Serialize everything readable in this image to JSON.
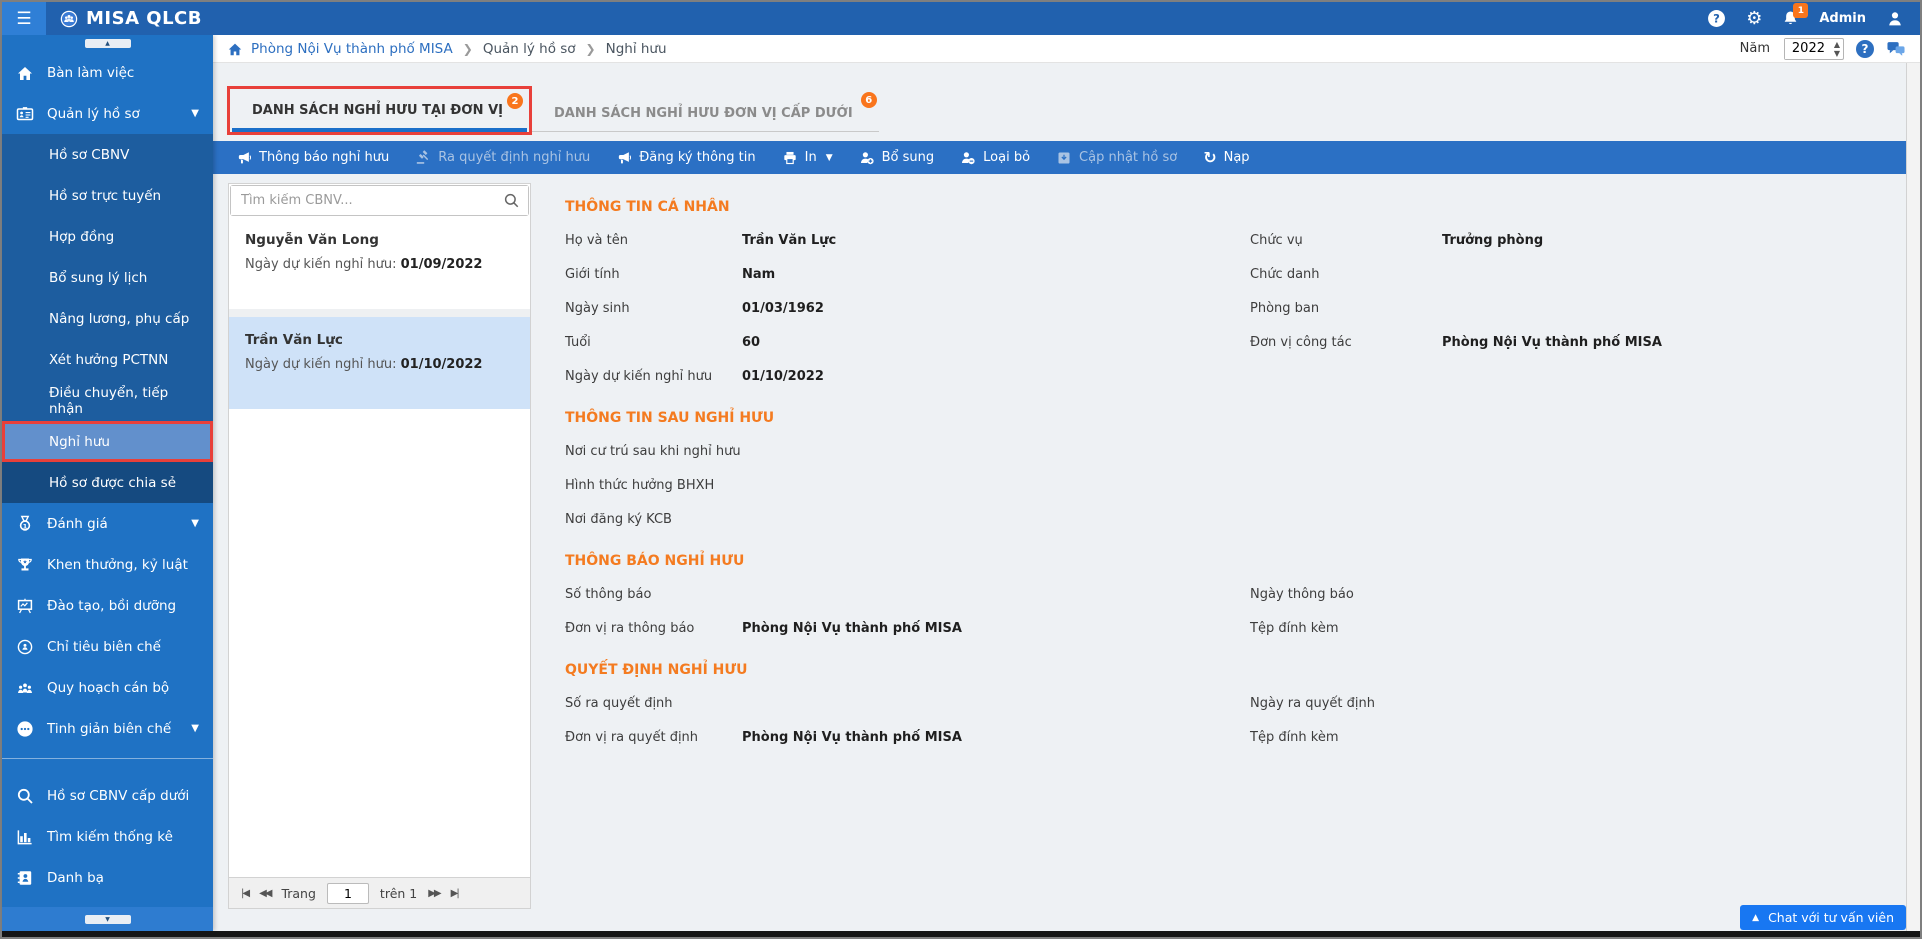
{
  "topbar": {
    "app_name": "MISA QLCB",
    "user_label": "Admin",
    "bell_badge": "1"
  },
  "breadcrumb": {
    "crumbs": [
      "Phòng Nội Vụ thành phố MISA",
      "Quản lý hồ sơ",
      "Nghỉ hưu"
    ],
    "separator": "❯"
  },
  "year_control": {
    "label": "Năm",
    "value": "2022"
  },
  "sidebar": {
    "top_items": [
      {
        "label": "Bàn làm việc"
      },
      {
        "label": "Quản lý hồ sơ"
      }
    ],
    "submenu": [
      {
        "label": "Hồ sơ CBNV"
      },
      {
        "label": "Hồ sơ trực tuyến"
      },
      {
        "label": "Hợp đồng"
      },
      {
        "label": "Bổ sung lý lịch"
      },
      {
        "label": "Nâng lương, phụ cấp"
      },
      {
        "label": "Xét hưởng PCTNN"
      },
      {
        "label": "Điều chuyển, tiếp nhận"
      },
      {
        "label": "Nghỉ hưu"
      },
      {
        "label": "Hồ sơ được chia sẻ"
      }
    ],
    "mid_items": [
      {
        "label": "Đánh giá"
      },
      {
        "label": "Khen thưởng, kỷ luật"
      },
      {
        "label": "Đào tạo, bồi dưỡng"
      },
      {
        "label": "Chỉ tiêu biên chế"
      },
      {
        "label": "Quy hoạch cán bộ"
      },
      {
        "label": "Tinh giản biên chế"
      }
    ],
    "bottom_items": [
      {
        "label": "Hồ sơ CBNV cấp dưới"
      },
      {
        "label": "Tìm kiếm thống kê"
      },
      {
        "label": "Danh bạ"
      }
    ]
  },
  "tabs": [
    {
      "label": "DANH SÁCH NGHỈ HƯU TẠI ĐƠN VỊ",
      "badge": "2"
    },
    {
      "label": "DANH SÁCH NGHỈ HƯU ĐƠN VỊ CẤP DƯỚI",
      "badge": "6"
    }
  ],
  "toolbar": {
    "items": [
      {
        "label": "Thông báo nghỉ hưu"
      },
      {
        "label": "Ra quyết định nghỉ hưu"
      },
      {
        "label": "Đăng ký thông tin"
      },
      {
        "label": "In"
      },
      {
        "label": "Bổ sung"
      },
      {
        "label": "Loại bỏ"
      },
      {
        "label": "Cập nhật hồ sơ"
      },
      {
        "label": "Nạp"
      }
    ]
  },
  "search": {
    "placeholder": "Tìm kiếm CBNV..."
  },
  "employee_list": [
    {
      "name": "Nguyễn Văn Long",
      "label": "Ngày dự kiến nghỉ hưu: ",
      "date": "01/09/2022"
    },
    {
      "name": "Trần Văn Lực",
      "label": "Ngày dự kiến nghỉ hưu: ",
      "date": "01/10/2022"
    }
  ],
  "pagination": {
    "prefix": "Trang",
    "page": "1",
    "suffix": "trên 1"
  },
  "sections": {
    "personal": {
      "title": "THÔNG TIN CÁ NHÂN",
      "rows": [
        {
          "l1": "Họ và tên",
          "v1": "Trần Văn Lực",
          "l2": "Chức vụ",
          "v2": "Trưởng phòng"
        },
        {
          "l1": "Giới tính",
          "v1": "Nam",
          "l2": "Chức danh",
          "v2": ""
        },
        {
          "l1": "Ngày sinh",
          "v1": "01/03/1962",
          "l2": "Phòng ban",
          "v2": ""
        },
        {
          "l1": "Tuổi",
          "v1": "60",
          "l2": "Đơn vị công tác",
          "v2": "Phòng Nội Vụ thành phố MISA"
        },
        {
          "l1": "Ngày dự kiến nghỉ hưu",
          "v1": "01/10/2022",
          "l2": "",
          "v2": ""
        }
      ]
    },
    "after": {
      "title": "THÔNG TIN SAU NGHỈ HƯU",
      "rows": [
        {
          "l1": "Nơi cư trú sau khi nghỉ hưu",
          "v1": "",
          "l2": "",
          "v2": ""
        },
        {
          "l1": "Hình thức hưởng BHXH",
          "v1": "",
          "l2": "",
          "v2": ""
        },
        {
          "l1": "Nơi đăng ký KCB",
          "v1": "",
          "l2": "",
          "v2": ""
        }
      ]
    },
    "notice": {
      "title": "THÔNG BÁO NGHỈ HƯU",
      "rows": [
        {
          "l1": "Số thông báo",
          "v1": "",
          "l2": "Ngày thông báo",
          "v2": ""
        },
        {
          "l1": "Đơn vị ra thông báo",
          "v1": "Phòng Nội Vụ thành phố MISA",
          "l2": "Tệp đính kèm",
          "v2": ""
        }
      ]
    },
    "decision": {
      "title": "QUYẾT ĐỊNH NGHỈ HƯU",
      "rows": [
        {
          "l1": "Số ra quyết định",
          "v1": "",
          "l2": "Ngày ra quyết định",
          "v2": ""
        },
        {
          "l1": "Đơn vị ra quyết định",
          "v1": "Phòng Nội Vụ thành phố MISA",
          "l2": "Tệp đính kèm",
          "v2": ""
        }
      ]
    }
  },
  "chat_button": {
    "label": "Chat với tư vấn viên",
    "glyph": "▲"
  }
}
